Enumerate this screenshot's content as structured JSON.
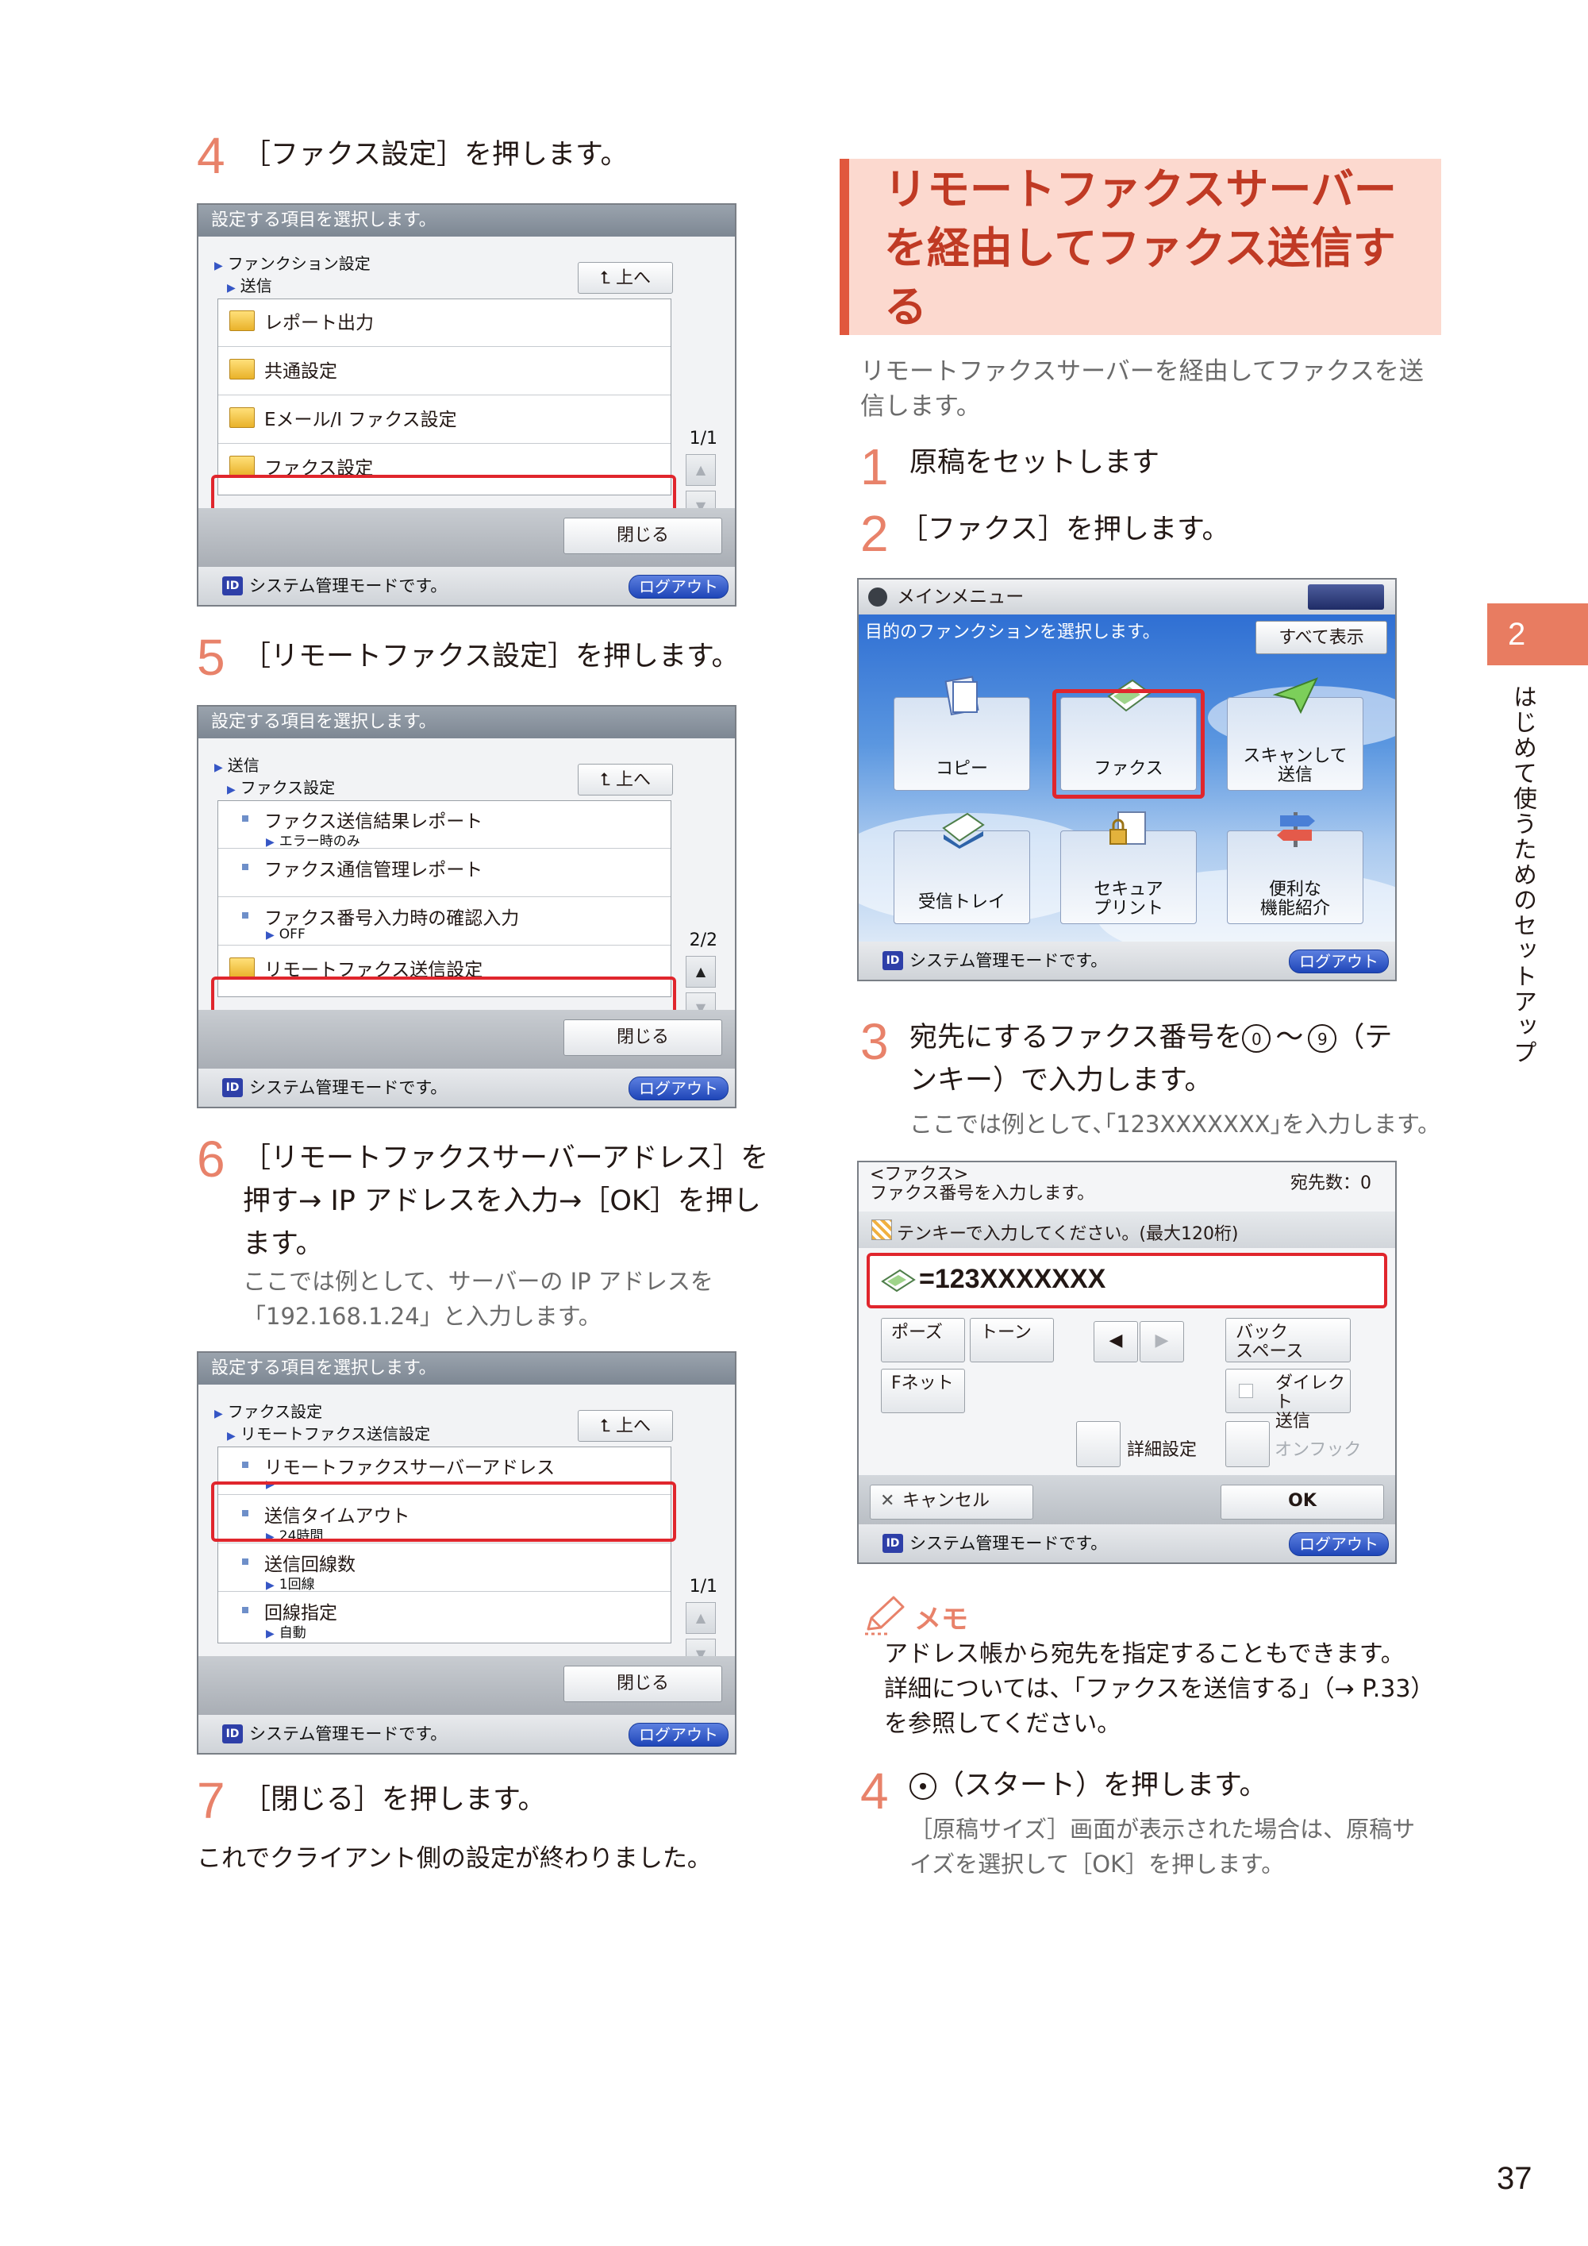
{
  "left": {
    "step4": {
      "num": "4",
      "text": "［ファクス設定］を押します。"
    },
    "screen1": {
      "header": "設定する項目を選択します。",
      "breadcrumb": [
        "ファンクション設定",
        "送信"
      ],
      "up": "上へ",
      "rows": [
        "レポート出力",
        "共通設定",
        "Eメール/I ファクス設定",
        "ファクス設定"
      ],
      "pager": "1/1",
      "close": "閉じる",
      "status": "システム管理モードです。",
      "logout": "ログアウト"
    },
    "step5": {
      "num": "5",
      "text": "［リモートファクス設定］を押します。"
    },
    "screen2": {
      "header": "設定する項目を選択します。",
      "breadcrumb": [
        "送信",
        "ファクス設定"
      ],
      "up": "上へ",
      "rows": [
        {
          "label": "ファクス送信結果レポート",
          "sub": "エラー時のみ"
        },
        {
          "label": "ファクス通信管理レポート",
          "sub": ""
        },
        {
          "label": "ファクス番号入力時の確認入力",
          "sub": "OFF"
        },
        {
          "label": "リモートファクス送信設定",
          "sub": ""
        }
      ],
      "pager": "2/2",
      "close": "閉じる",
      "status": "システム管理モードです。",
      "logout": "ログアウト"
    },
    "step6": {
      "num": "6",
      "line1": "［リモートファクスサーバーアドレス］を",
      "line2": "押す→ IP アドレスを入力→［OK］を押し",
      "line3": "ます。",
      "note1": "ここでは例として、サーバーの IP アドレスを",
      "note2": "「192.168.1.24」と入力します。"
    },
    "screen3": {
      "header": "設定する項目を選択します。",
      "breadcrumb": [
        "ファクス設定",
        "リモートファクス送信設定"
      ],
      "up": "上へ",
      "rows": [
        {
          "label": "リモートファクスサーバーアドレス",
          "sub": ""
        },
        {
          "label": "送信タイムアウト",
          "sub": "24時間"
        },
        {
          "label": "送信回線数",
          "sub": "1回線"
        },
        {
          "label": "回線指定",
          "sub": "自動"
        }
      ],
      "pager": "1/1",
      "close": "閉じる",
      "status": "システム管理モードです。",
      "logout": "ログアウト"
    },
    "step7": {
      "num": "7",
      "text": "［閉じる］を押します。"
    },
    "closing": "これでクライアント側の設定が終わりました。"
  },
  "right": {
    "heading": [
      "リモートファクスサーバー",
      "を経由してファクス送信す",
      "る"
    ],
    "intro1": "リモートファクスサーバーを経由してファクスを送",
    "intro2": "信します。",
    "step1": {
      "num": "1",
      "text": "原稿をセットします"
    },
    "step2": {
      "num": "2",
      "text": "［ファクス］を押します。"
    },
    "mainmenu": {
      "title": "メインメニュー",
      "subtitle": "目的のファンクションを選択します。",
      "show_all": "すべて表示",
      "tiles": [
        [
          "コピー"
        ],
        [
          "ファクス"
        ],
        [
          "スキャンして",
          "送信"
        ],
        [
          "受信トレイ"
        ],
        [
          "セキュア",
          "プリント"
        ],
        [
          "便利な",
          "機能紹介"
        ]
      ],
      "status": "システム管理モードです。",
      "logout": "ログアウト"
    },
    "step3": {
      "num": "3",
      "line1a": "宛先にするファクス番号を",
      "key0": "0",
      "tilde": "～",
      "key9": "9",
      "line1b": "（テ",
      "line2": "ンキー）で入力します。",
      "note": "ここでは例として､｢123XXXXXXX｣を入力します。"
    },
    "faxscreen": {
      "title": "<ファクス>",
      "prompt": "ファクス番号を入力します。",
      "dest_count": "宛先数：0",
      "hint": "テンキーで入力してください。(最大120桁)",
      "number": "=123XXXXXXX",
      "pause": "ポーズ",
      "tone": "トーン",
      "backspace": [
        "バック",
        "スペース"
      ],
      "fnet": "Fネット",
      "direct": [
        "ダイレクト",
        "送信"
      ],
      "detail": "詳細設定",
      "onhook": "オンフック",
      "cancel": "キャンセル",
      "ok": "OK",
      "status": "システム管理モードです。",
      "logout": "ログアウト"
    },
    "memo": {
      "title": "メモ",
      "line1": "アドレス帳から宛先を指定することもできます。",
      "line2": "詳細については、「ファクスを送信する」（→ P.33）",
      "line3": "を参照してください。"
    },
    "step4": {
      "num": "4",
      "text": "（スタート）を押します。",
      "note1": "［原稿サイズ］画面が表示された場合は、原稿サ",
      "note2": "イズを選択して［OK］を押します。"
    }
  },
  "side": {
    "chapter": "2",
    "label": "はじめて使うためのセットアップ"
  },
  "page_number": "37"
}
